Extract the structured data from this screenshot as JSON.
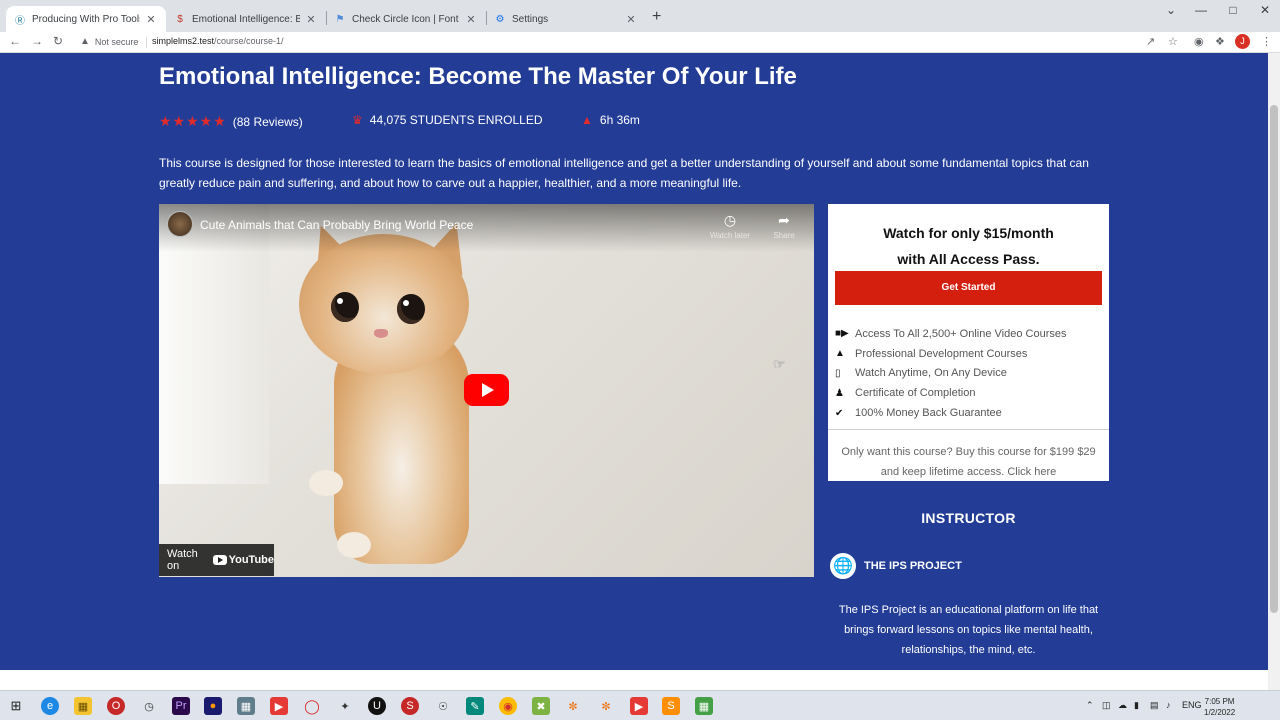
{
  "browser": {
    "tabs": [
      {
        "title": "Producing With Pro Tools First -",
        "icon": "wordpress-icon",
        "active": true
      },
      {
        "title": "Emotional Intelligence: Become",
        "icon": "simple-lms-icon",
        "active": false
      },
      {
        "title": "Check Circle Icon | Font Awesom",
        "icon": "flag-icon",
        "active": false
      },
      {
        "title": "Settings",
        "icon": "gear-icon",
        "active": false
      }
    ],
    "security_label": "Not secure",
    "url_host": "simplelms2.test",
    "url_path": "/course/course-1/",
    "profile_initial": "J"
  },
  "course": {
    "title": "Emotional Intelligence: Become The Master Of Your Life",
    "rating_stars": 5,
    "reviews": "(88 Reviews)",
    "students": "44,075 STUDENTS ENROLLED",
    "duration": "6h 36m",
    "description": "This course is designed for those interested to learn the basics of emotional intelligence and get a better understanding of yourself and about some fundamental topics that can greatly reduce pain and suffering, and about how to carve out a happier, healthier, and a more meaningful life."
  },
  "video": {
    "title": "Cute Animals that Can Probably Bring World Peace",
    "watch_later": "Watch later",
    "share": "Share",
    "watch_on": "Watch on",
    "youtube": "YouTube"
  },
  "pricing": {
    "headline_1": "Watch for only $15/month",
    "headline_2": "with All Access Pass.",
    "cta": "Get Started",
    "features": [
      {
        "icon": "video-camera-icon",
        "label": "Access To All 2,500+ Online Video Courses"
      },
      {
        "icon": "graduation-cap-icon",
        "label": "Professional Development Courses"
      },
      {
        "icon": "tablet-icon",
        "label": "Watch Anytime, On Any Device"
      },
      {
        "icon": "certificate-stamp-icon",
        "label": "Certificate of Completion"
      },
      {
        "icon": "check-circle-icon",
        "label": "100% Money Back Guarantee"
      }
    ],
    "buy_line_1": "Only want this course? Buy this course for $199 $29",
    "buy_line_2": "and keep lifetime access. Click here"
  },
  "instructor": {
    "heading": "INSTRUCTOR",
    "name": "THE IPS PROJECT",
    "bio": "The IPS Project is an educational platform on life that brings forward lessons on topics like mental health, relationships, the mind, etc."
  },
  "taskbar": {
    "language": "ENG",
    "time": "7:05 PM",
    "date": "1/2/2022"
  }
}
